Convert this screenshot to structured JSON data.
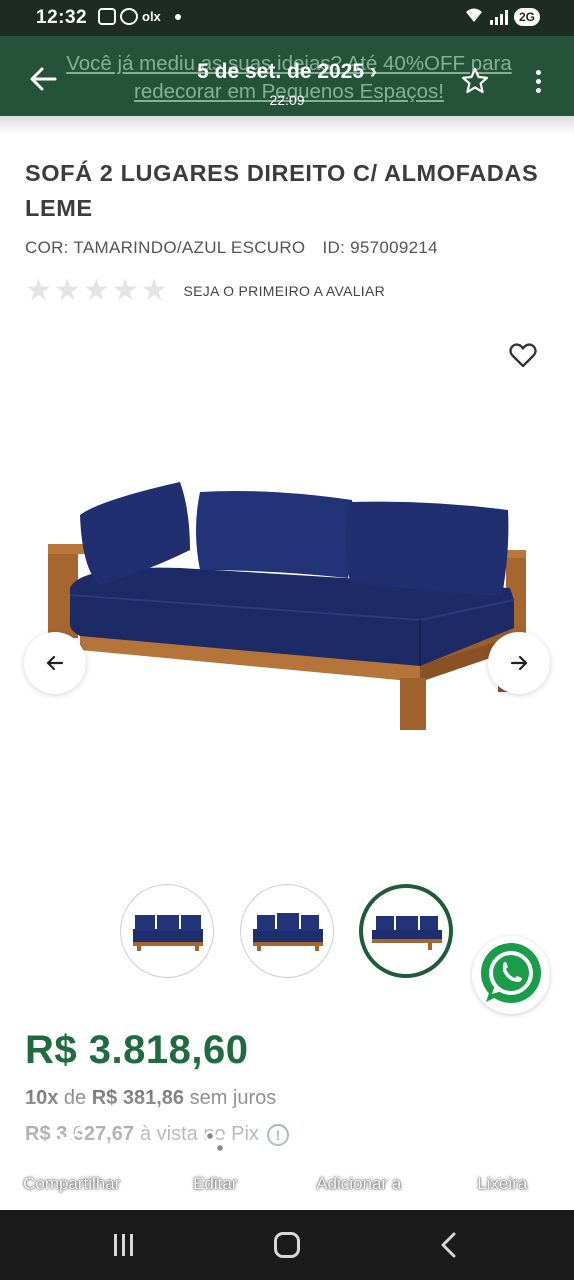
{
  "status_bar": {
    "time": "12:32",
    "network": "2G",
    "app_label": "olx"
  },
  "banner": {
    "promo_text": "Você já mediu as suas ideias? Até 40%OFF para redecorar em Pequenos Espaços!",
    "date_text": "5 de set. de 2025 ›",
    "time_text": "22:09"
  },
  "product": {
    "title": "SOFÁ 2 LUGARES DIREITO C/ ALMOFADAS LEME",
    "color_label": "COR: TAMARINDO/AZUL ESCURO",
    "id_label": "ID: 957009214",
    "rating_label": "SEJA O PRIMEIRO A AVALIAR",
    "stars_filled": 0,
    "stars_total": 5,
    "price": "R$ 3.818,60",
    "installments": {
      "count": "10x",
      "connector": " de ",
      "amount": "R$ 381,86",
      "suffix": " sem juros"
    },
    "pix": {
      "amount": "R$ 3.627,67",
      "suffix": "à vista no Pix"
    },
    "thumbnails_count": 3,
    "active_thumbnail": 3
  },
  "colors": {
    "brand_green": "#1f6a3f",
    "banner_green": "#24533a",
    "sofa_blue": "#1e2d6b",
    "wood": "#a5672f"
  },
  "actions": [
    {
      "label": "Compartilhar",
      "icon": "share-icon"
    },
    {
      "label": "Editar",
      "icon": "edit-sliders-icon"
    },
    {
      "label": "Adicionar a",
      "icon": "plus-icon"
    },
    {
      "label": "Lixeira",
      "icon": "trash-icon"
    }
  ]
}
